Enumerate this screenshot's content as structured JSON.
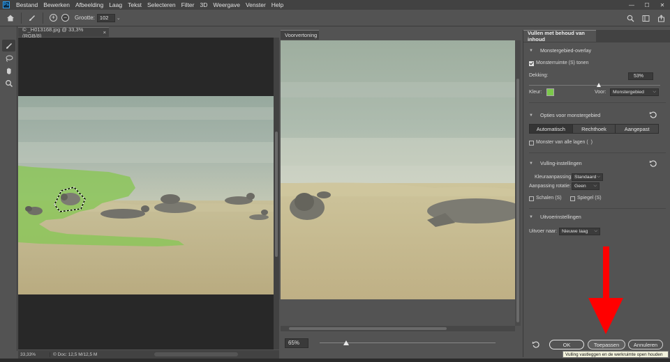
{
  "menubar": {
    "logo": "Ps",
    "items": [
      "Bestand",
      "Bewerken",
      "Afbeelding",
      "Laag",
      "Tekst",
      "Selecteren",
      "Filter",
      "3D",
      "Weergave",
      "Venster",
      "Help"
    ],
    "window_controls": [
      "—",
      "☐",
      "✕"
    ]
  },
  "optionsbar": {
    "add_symbol": "+",
    "subtract_symbol": "−",
    "size_label": "Grootte:",
    "size_value": "102",
    "size_caret": "⌄"
  },
  "document": {
    "tab_title": "© _H013168.jpg @ 33,3% (RGB/8)",
    "tab_close": "×",
    "status_zoom": "33,33%",
    "status_doc": "© Doc: 12,5 M/12,5 M"
  },
  "preview": {
    "tab_title": "Voorvertoning",
    "zoom_value": "65%",
    "zoom_slider_fraction": 0.15
  },
  "panel": {
    "tab_title": "Vullen met behoud van inhoud",
    "overlay": {
      "header": "Monstergebied-overlay",
      "show_sample_label": "Monsterruimte (S) tonen",
      "show_sample_checked": true,
      "opacity_label": "Dekking:",
      "opacity_value": "53%",
      "opacity_fraction": 0.53,
      "color_label": "Kleur:",
      "color_hex": "#7bc84a",
      "for_label": "Voor:",
      "for_value": "Monstergebied"
    },
    "sampling": {
      "header": "Opties voor monstergebied",
      "segments": [
        "Automatisch",
        "Rechthoek",
        "Aangepast"
      ],
      "active_segment": 0,
      "all_layers_label": "Monster van alle lagen (",
      "all_layers_shortcut": ")",
      "all_layers_checked": false
    },
    "fill": {
      "header": "Vulling-instellingen",
      "color_adapt_label": "Kleuraanpassing:",
      "color_adapt_value": "Standaard",
      "rotation_label": "Aanpassing rotatie:",
      "rotation_value": "Geen",
      "scale_label": "Schalen (S)",
      "scale_checked": false,
      "mirror_label": "Spiegel (S)",
      "mirror_checked": false
    },
    "output": {
      "header": "Uitvoerinstellingen",
      "output_label": "Uitvoer naar:",
      "output_value": "Nieuwe laag"
    },
    "buttons": {
      "ok": "OK",
      "apply": "Toepassen",
      "cancel": "Annuleren"
    },
    "tooltip": "Vulling vastleggen en de werkruimte open houden"
  },
  "colors": {
    "accent_green": "#7bc84a",
    "annotation_red": "#ff0000",
    "ps_blue": "#2fa3f7"
  },
  "icons": {
    "home": "home-icon",
    "brush": "sampling-brush-icon",
    "lasso": "lasso-icon",
    "hand": "hand-icon",
    "zoom": "zoom-icon",
    "search": "search-icon",
    "workspace": "workspace-icon",
    "share": "share-icon",
    "reset": "reset-icon"
  }
}
